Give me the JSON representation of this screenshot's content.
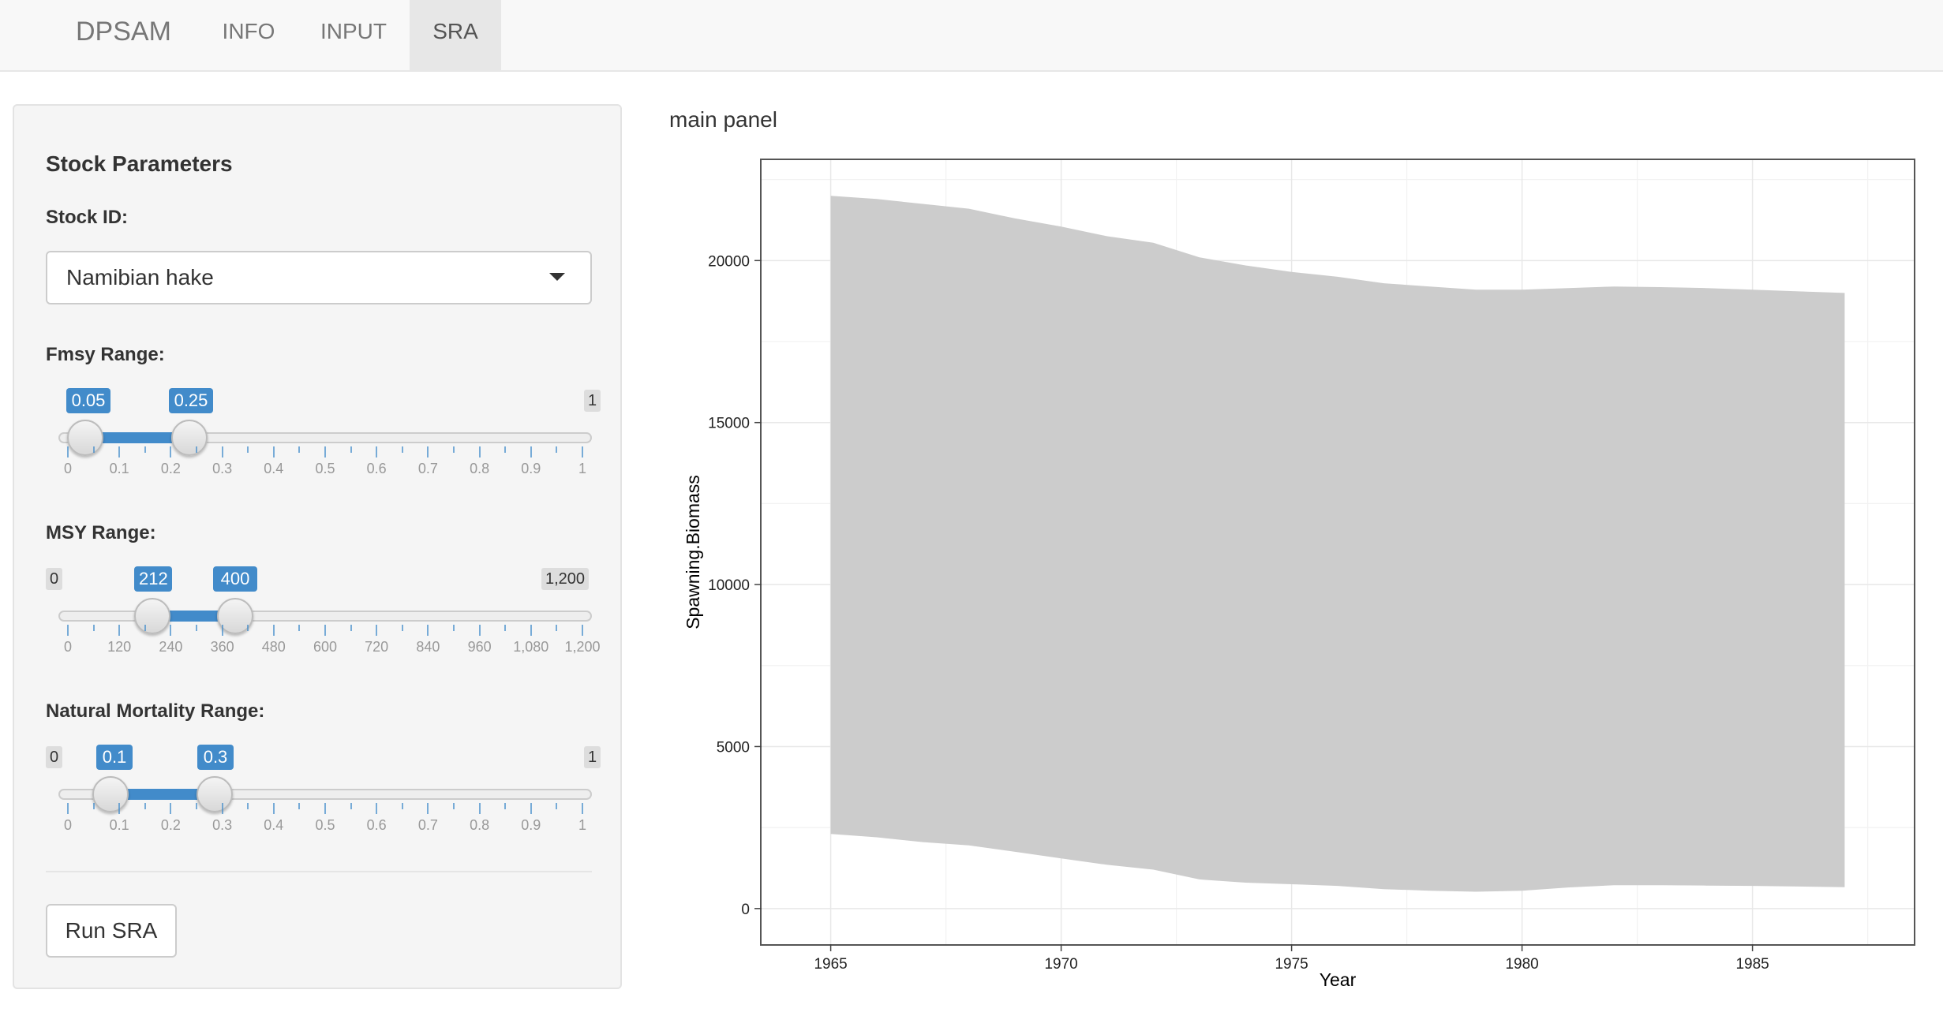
{
  "navbar": {
    "brand": "DPSAM",
    "tabs": [
      {
        "label": "INFO",
        "active": false
      },
      {
        "label": "INPUT",
        "active": false
      },
      {
        "label": "SRA",
        "active": true
      }
    ]
  },
  "sidebar": {
    "title": "Stock Parameters",
    "stock_id": {
      "label": "Stock ID:",
      "value": "Namibian hake"
    },
    "fmsy": {
      "label": "Fmsy Range:",
      "min": "0",
      "max": "1",
      "low": "0.05",
      "high": "0.25",
      "ticks": [
        "0",
        "0.1",
        "0.2",
        "0.3",
        "0.4",
        "0.5",
        "0.6",
        "0.7",
        "0.8",
        "0.9",
        "1"
      ]
    },
    "msy": {
      "label": "MSY Range:",
      "min": "0",
      "max": "1,200",
      "low": "212",
      "high": "400",
      "ticks": [
        "0",
        "120",
        "240",
        "360",
        "480",
        "600",
        "720",
        "840",
        "960",
        "1,080",
        "1,200"
      ]
    },
    "mortality": {
      "label": "Natural Mortality Range:",
      "min": "0",
      "max": "1",
      "low": "0.1",
      "high": "0.3",
      "ticks": [
        "0",
        "0.1",
        "0.2",
        "0.3",
        "0.4",
        "0.5",
        "0.6",
        "0.7",
        "0.8",
        "0.9",
        "1"
      ]
    },
    "run_button": "Run SRA"
  },
  "main": {
    "title": "main panel"
  },
  "chart_data": {
    "type": "area",
    "title": "",
    "xlabel": "Year",
    "ylabel": "Spawning.Biomass",
    "x_ticks": [
      1965,
      1970,
      1975,
      1980,
      1985
    ],
    "y_ticks": [
      0,
      5000,
      10000,
      15000,
      20000
    ],
    "xlim": [
      1963.5,
      1988.5
    ],
    "ylim": [
      -1100,
      23100
    ],
    "grid": true,
    "fill_color": "#cccccc",
    "x": [
      1965,
      1966,
      1967,
      1968,
      1969,
      1970,
      1971,
      1972,
      1973,
      1974,
      1975,
      1976,
      1977,
      1978,
      1979,
      1980,
      1981,
      1982,
      1983,
      1984,
      1985,
      1986,
      1987
    ],
    "upper": [
      22000,
      21900,
      21750,
      21600,
      21300,
      21050,
      20750,
      20550,
      20100,
      19850,
      19650,
      19500,
      19300,
      19200,
      19100,
      19100,
      19150,
      19200,
      19180,
      19150,
      19100,
      19050,
      19000
    ],
    "lower": [
      2300,
      2200,
      2050,
      1950,
      1750,
      1550,
      1350,
      1200,
      900,
      800,
      750,
      700,
      600,
      550,
      520,
      550,
      650,
      720,
      720,
      710,
      700,
      680,
      660
    ]
  }
}
